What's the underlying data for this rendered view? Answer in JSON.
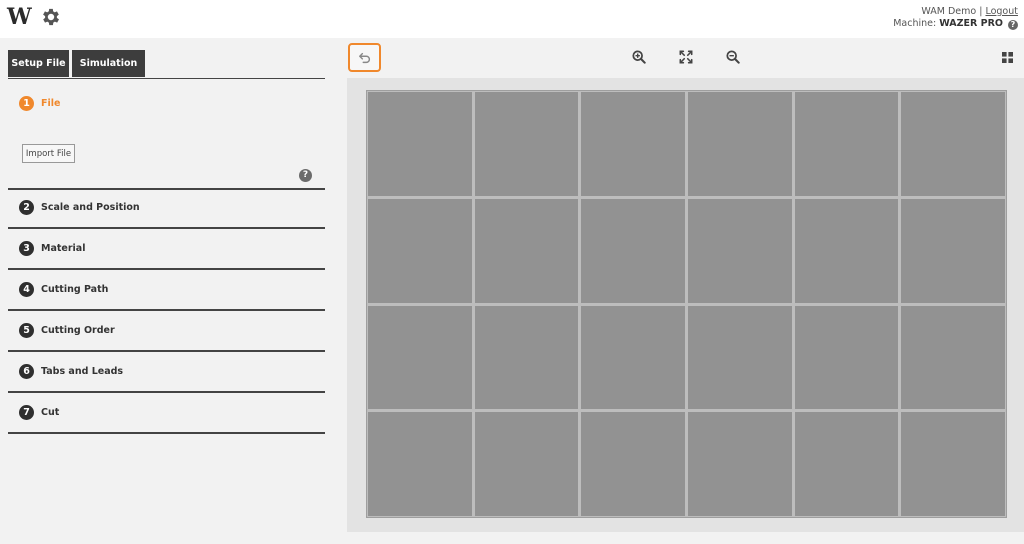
{
  "header": {
    "logo_letter": "W",
    "user_name": "WAM Demo",
    "separator": "|",
    "logout_label": "Logout",
    "machine_label": "Machine:",
    "machine_name": "WAZER PRO",
    "help_glyph": "?"
  },
  "tabs": [
    {
      "label": "Setup File"
    },
    {
      "label": "Simulation"
    }
  ],
  "steps": [
    {
      "number": "1",
      "label": "File"
    },
    {
      "number": "2",
      "label": "Scale and Position"
    },
    {
      "number": "3",
      "label": "Material"
    },
    {
      "number": "4",
      "label": "Cutting Path"
    },
    {
      "number": "5",
      "label": "Cutting Order"
    },
    {
      "number": "6",
      "label": "Tabs and Leads"
    },
    {
      "number": "7",
      "label": "Cut"
    }
  ],
  "file_step": {
    "import_label": "Import File",
    "help_glyph": "?"
  },
  "toolbar": {
    "icons": [
      "undo-icon",
      "zoom-in-icon",
      "fit-screen-icon",
      "zoom-out-icon",
      "grid-view-icon"
    ]
  },
  "canvas": {
    "columns": 6,
    "rows": 4
  },
  "colors": {
    "accent": "#f0882c",
    "dark": "#3d3d3d",
    "cell": "#929292",
    "canvas_bg": "#e3e3e3"
  }
}
